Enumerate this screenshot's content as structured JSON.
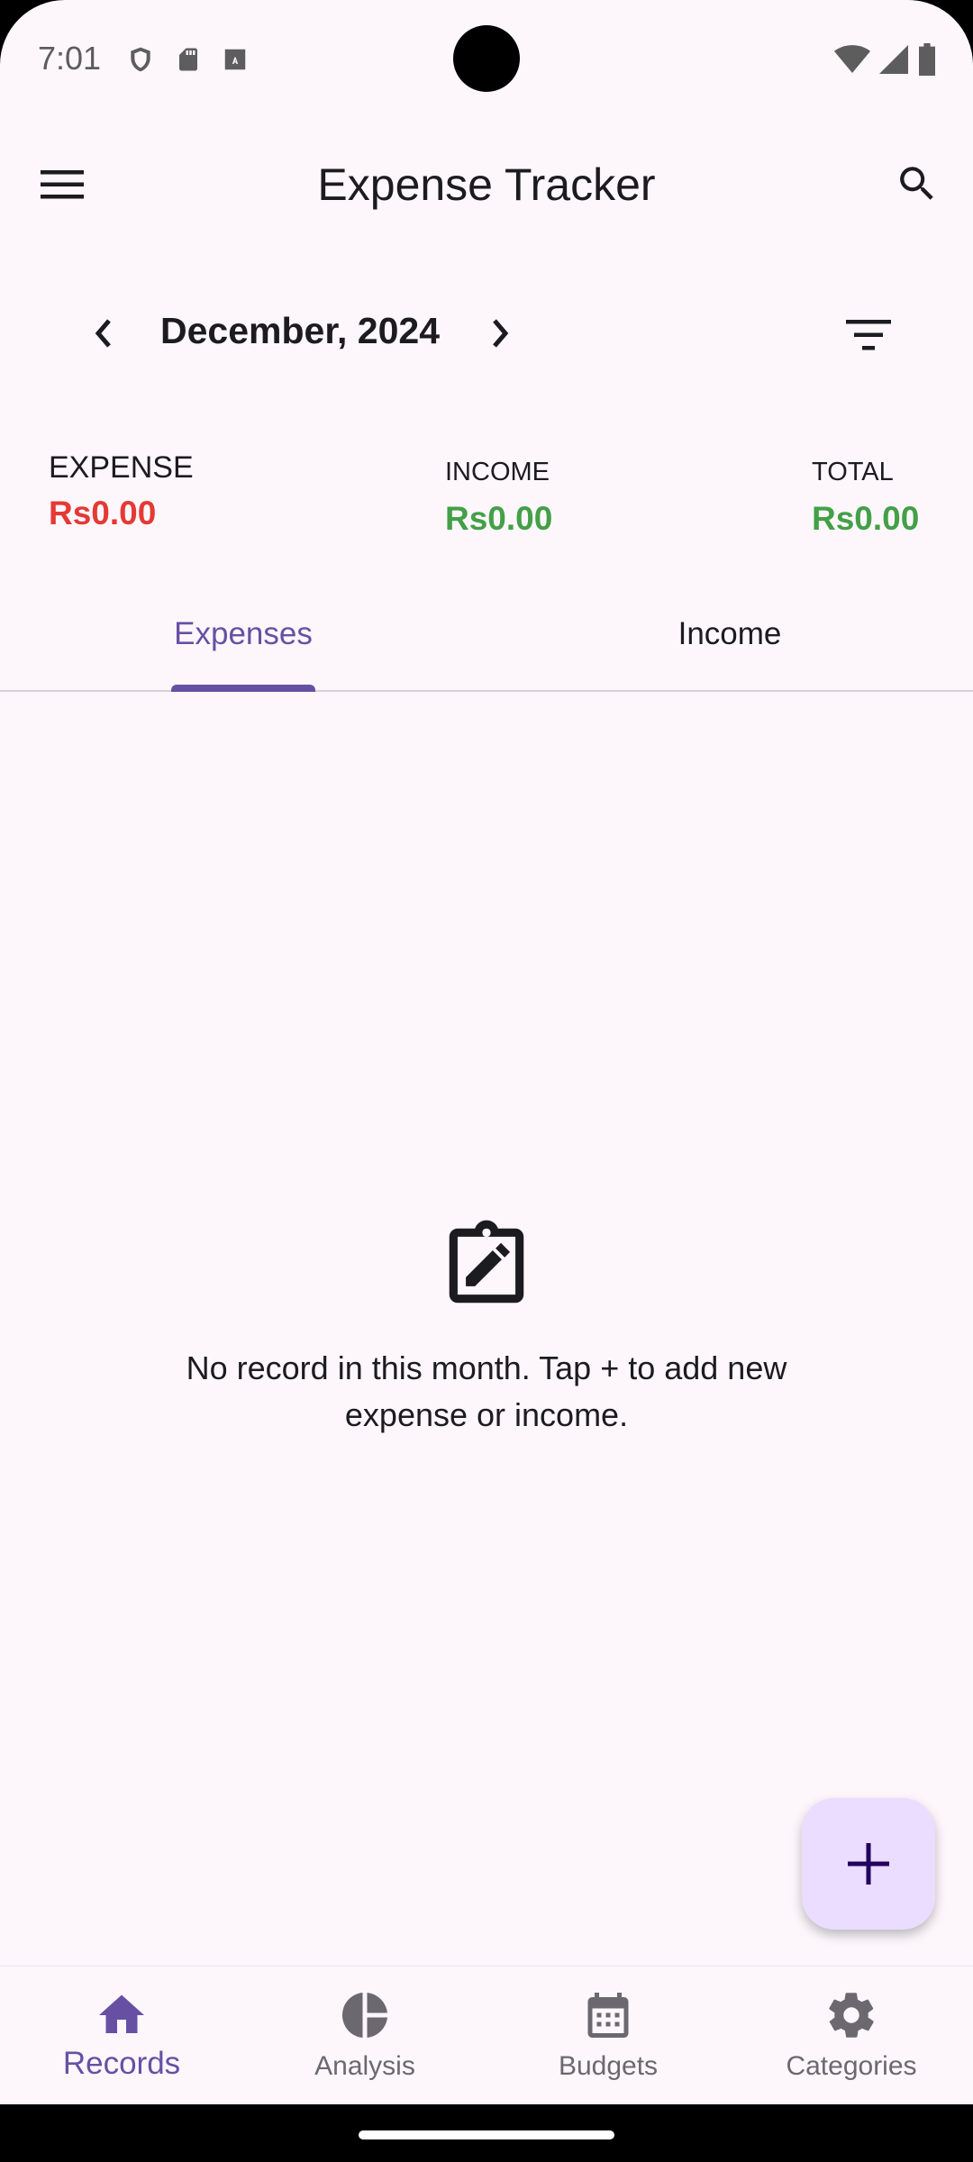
{
  "status_bar": {
    "time": "7:01",
    "icons_left": [
      "shield-icon",
      "sd-card-icon",
      "font-download-icon"
    ],
    "icons_right": [
      "wifi-icon",
      "signal-icon",
      "battery-icon"
    ]
  },
  "app_bar": {
    "title": "Expense Tracker",
    "menu_icon": "menu-icon",
    "search_icon": "search-icon"
  },
  "month_nav": {
    "label": "December, 2024",
    "prev_icon": "chevron-left-icon",
    "next_icon": "chevron-right-icon",
    "filter_icon": "filter-icon"
  },
  "summary": {
    "expense": {
      "label": "EXPENSE",
      "value": "Rs0.00",
      "color": "#e53935"
    },
    "income": {
      "label": "INCOME",
      "value": "Rs0.00",
      "color": "#43a047"
    },
    "total": {
      "label": "TOTAL",
      "value": "Rs0.00",
      "color": "#43a047"
    }
  },
  "tabs": [
    {
      "label": "Expenses",
      "selected": true
    },
    {
      "label": "Income",
      "selected": false
    }
  ],
  "empty_state": {
    "icon": "edit-clipboard-icon",
    "message": "No record in this month. Tap + to add new expense or income."
  },
  "fab": {
    "icon": "plus-icon"
  },
  "bottom_nav": [
    {
      "label": "Records",
      "icon": "home-icon",
      "selected": true
    },
    {
      "label": "Analysis",
      "icon": "pie-chart-icon",
      "selected": false
    },
    {
      "label": "Budgets",
      "icon": "calendar-icon",
      "selected": false
    },
    {
      "label": "Categories",
      "icon": "settings-icon",
      "selected": false
    }
  ],
  "colors": {
    "accent": "#6750a4",
    "background": "#fdf7fc",
    "fab_background": "#eaddff",
    "expense": "#e53935",
    "income": "#43a047"
  }
}
